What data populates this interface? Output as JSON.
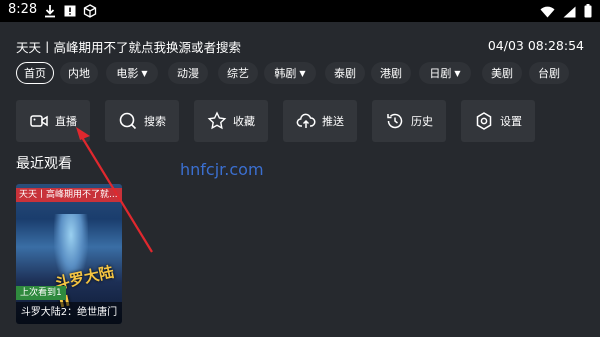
{
  "status_bar": {
    "time": "8:28",
    "left_icons": [
      "download-icon",
      "alert-icon",
      "cube-icon"
    ],
    "right_icons": [
      "wifi-icon",
      "signal-icon",
      "battery-icon"
    ]
  },
  "header": {
    "title": "天天丨高峰期用不了就点我换源或者搜索",
    "datetime": "04/03 08:28:54"
  },
  "categories": [
    {
      "label": "首页",
      "active": true,
      "dropdown": false
    },
    {
      "label": "内地",
      "active": false,
      "dropdown": false
    },
    {
      "label": "电影",
      "active": false,
      "dropdown": true
    },
    {
      "label": "动漫",
      "active": false,
      "dropdown": false
    },
    {
      "label": "综艺",
      "active": false,
      "dropdown": false
    },
    {
      "label": "韩剧",
      "active": false,
      "dropdown": true
    },
    {
      "label": "泰剧",
      "active": false,
      "dropdown": false
    },
    {
      "label": "港剧",
      "active": false,
      "dropdown": false
    },
    {
      "label": "日剧",
      "active": false,
      "dropdown": true
    },
    {
      "label": "美剧",
      "active": false,
      "dropdown": false
    },
    {
      "label": "台剧",
      "active": false,
      "dropdown": false
    }
  ],
  "dropdown_glyph": "▼",
  "actions": [
    {
      "label": "直播",
      "icon": "video-camera-icon"
    },
    {
      "label": "搜索",
      "icon": "search-icon"
    },
    {
      "label": "收藏",
      "icon": "star-icon"
    },
    {
      "label": "推送",
      "icon": "cloud-upload-icon"
    },
    {
      "label": "历史",
      "icon": "history-icon"
    },
    {
      "label": "设置",
      "icon": "settings-icon"
    }
  ],
  "recent": {
    "title": "最近观看",
    "items": [
      {
        "tag": "天天丨高峰期用不了就...",
        "last_seen": "上次看到1",
        "name": "斗罗大陆2：绝世唐门",
        "poster_text": "斗罗大陆II"
      }
    ]
  },
  "watermark": "hnfcjr.com",
  "colors": {
    "background": "#26292e",
    "tile": "#33363b",
    "tag_red": "#c8323a",
    "last_seen_green": "#2f8a3e",
    "arrow_red": "#e0282e",
    "watermark_blue": "#3b6fd0"
  }
}
